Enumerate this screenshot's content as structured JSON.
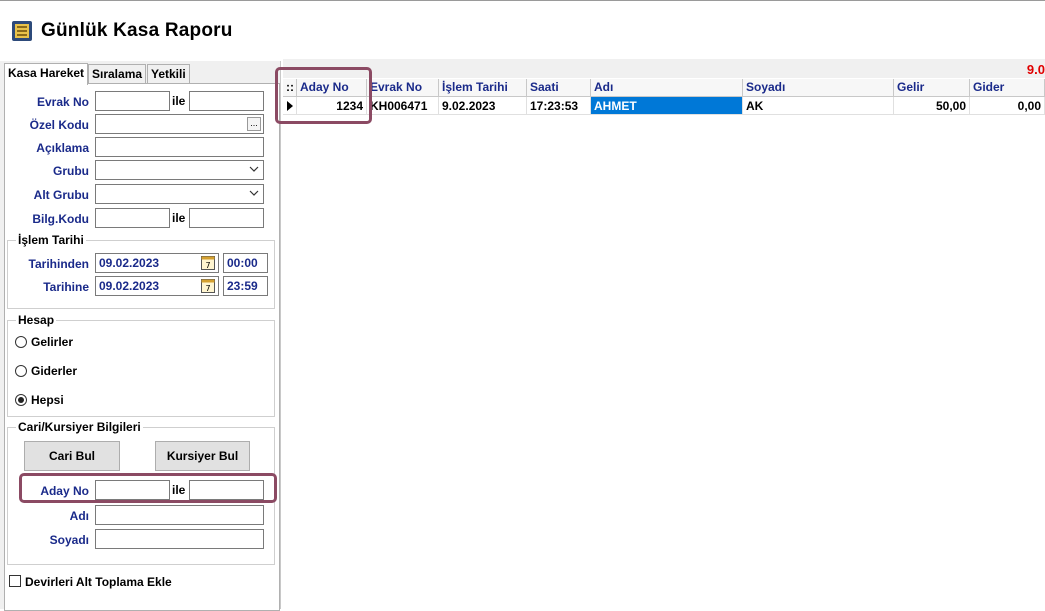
{
  "window": {
    "title": "Günlük Kasa Raporu"
  },
  "tabs": [
    {
      "label": "Kasa Hareket"
    },
    {
      "label": "Sıralama"
    },
    {
      "label": "Yetkili"
    }
  ],
  "filters": {
    "evrak_no": {
      "label": "Evrak No",
      "from": "",
      "to": ""
    },
    "ile": "ile",
    "ozel_kodu": {
      "label": "Özel Kodu",
      "value": "",
      "button": "..."
    },
    "aciklama": {
      "label": "Açıklama",
      "value": ""
    },
    "grubu": {
      "label": "Grubu",
      "value": ""
    },
    "alt_grubu": {
      "label": "Alt Grubu",
      "value": ""
    },
    "bilg_kodu": {
      "label": "Bilg.Kodu",
      "from": "",
      "to": ""
    }
  },
  "islem_tarihi": {
    "title": "İşlem Tarihi",
    "from_label": "Tarihinden",
    "from_date": "09.02.2023",
    "from_time": "00:00",
    "to_label": "Tarihine",
    "to_date": "09.02.2023",
    "to_time": "23:59"
  },
  "hesap": {
    "title": "Hesap",
    "options": [
      {
        "label": "Gelirler",
        "selected": false
      },
      {
        "label": "Giderler",
        "selected": false
      },
      {
        "label": "Hepsi",
        "selected": true
      }
    ]
  },
  "cari": {
    "title": "Cari/Kursiyer Bilgileri",
    "cari_bul": "Cari Bul",
    "kursiyer_bul": "Kursiyer Bul",
    "aday_no": {
      "label": "Aday No",
      "from": "",
      "to": ""
    },
    "adi": {
      "label": "Adı",
      "value": ""
    },
    "soyadi": {
      "label": "Soyadı",
      "value": ""
    }
  },
  "devir": {
    "label": "Devirleri Alt Toplama Ekle",
    "checked": false
  },
  "grid": {
    "corner": "::",
    "top_right_value": "9.0",
    "columns": [
      "Aday No",
      "Evrak No",
      "İşlem Tarihi",
      "Saati",
      "Adı",
      "Soyadı",
      "Gelir",
      "Gider"
    ],
    "rows": [
      {
        "aday_no": "1234",
        "evrak_no": "KH006471",
        "islem_tarihi": "9.02.2023",
        "saati": "17:23:53",
        "adi": "AHMET",
        "soyadi": "AK",
        "gelir": "50,00",
        "gider": "0,00"
      }
    ]
  },
  "colors": {
    "label_blue": "#1a2a8a",
    "highlight": "#8b4a63",
    "selection": "#0078d7",
    "red": "#e00000"
  },
  "icons": {
    "app": "cash-register-icon",
    "calendar": "calendar-icon",
    "combo": "chevron-down-icon",
    "row_pointer": "row-pointer-icon"
  }
}
